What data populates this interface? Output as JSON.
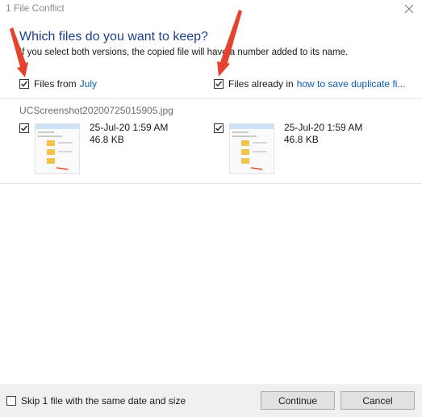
{
  "window": {
    "title": "1 File Conflict"
  },
  "header": {
    "heading": "Which files do you want to keep?",
    "subtext": "If you select both versions, the copied file will have a number added to its name."
  },
  "columns": {
    "left": {
      "label_prefix": "Files from ",
      "location": "July",
      "checked": true
    },
    "right": {
      "label_prefix": "Files already in ",
      "location": "how to save duplicate fi...",
      "checked": true
    }
  },
  "file": {
    "name": "UCScreenshot20200725015905.jpg",
    "left": {
      "date": "25-Jul-20 1:59 AM",
      "size": "46.8 KB",
      "checked": true
    },
    "right": {
      "date": "25-Jul-20 1:59 AM",
      "size": "46.8 KB",
      "checked": true
    }
  },
  "footer": {
    "skip_label": "Skip 1 file with the same date and size",
    "skip_checked": false,
    "continue_label": "Continue",
    "cancel_label": "Cancel"
  },
  "colors": {
    "heading": "#1d3f8a",
    "link": "#0a5fb0",
    "annotation_arrow": "#e5432d"
  }
}
